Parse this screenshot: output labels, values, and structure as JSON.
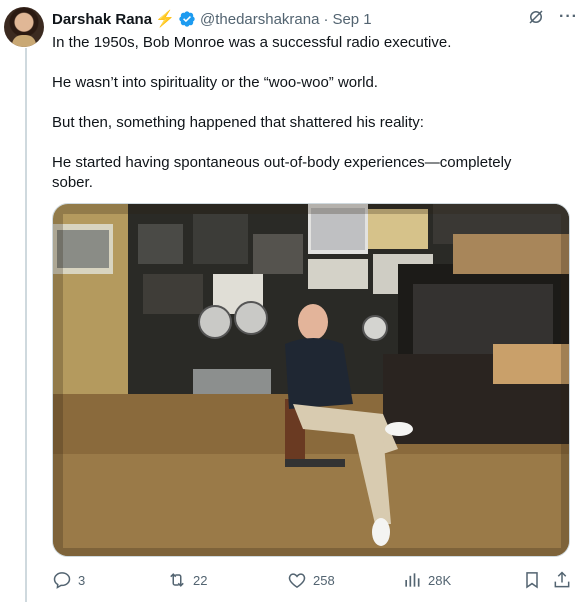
{
  "author": {
    "name": "Darshak Rana",
    "handle": "@thedarshakrana",
    "separator": "·",
    "date": "Sep 1"
  },
  "icons": {
    "bolt": "lightning-bolt-icon",
    "verified": "verified-badge-icon",
    "grok": "grok-icon",
    "more": "more-icon",
    "reply": "reply-icon",
    "repost": "repost-icon",
    "like": "like-icon",
    "views": "views-icon",
    "bookmark": "bookmark-icon",
    "share": "share-icon"
  },
  "colors": {
    "text": "#0f1419",
    "secondary": "#536471",
    "verified": "#1d9bf0",
    "bolt": "#f4b400"
  },
  "tweet": {
    "paragraphs": [
      "In the 1950s, Bob Monroe was a successful radio executive.",
      "He wasn’t into spirituality or the “woo-woo” world.",
      "But then, something happened that shattered his reality:",
      "He started having spontaneous out-of-body experiences—completely sober."
    ]
  },
  "more_symbol": "···",
  "stats": {
    "replies": "3",
    "reposts": "22",
    "likes": "258",
    "views": "28K"
  }
}
